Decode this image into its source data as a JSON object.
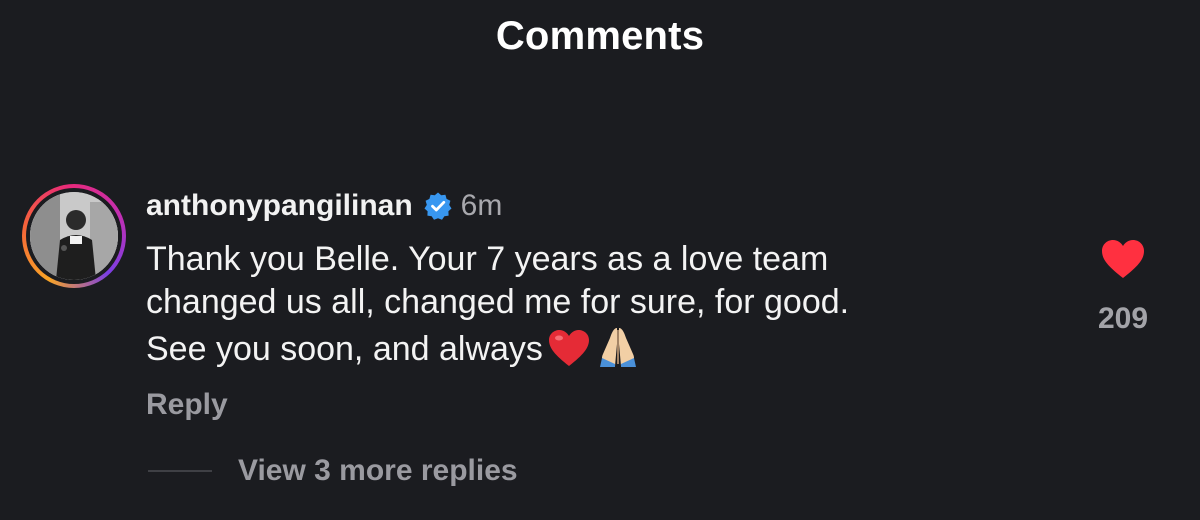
{
  "header": {
    "title": "Comments"
  },
  "comment": {
    "username": "anthonypangilinan",
    "verified": true,
    "timestamp": "6m",
    "text_lines": [
      "Thank you Belle. Your 7 years as a love team",
      "changed us all, changed me for sure, for good.",
      "See you soon, and always"
    ],
    "emojis": [
      "red-heart-emoji",
      "folded-hands-emoji"
    ],
    "reply_label": "Reply",
    "like_count": "209",
    "liked": true,
    "view_replies_label": "View 3 more replies"
  },
  "icons": {
    "verified": "verified-badge-icon",
    "like": "heart-icon"
  },
  "colors": {
    "background": "#1b1c20",
    "verified_badge": "#3897f0",
    "liked_heart": "#ff3040",
    "secondary_text": "#9a9aa0"
  }
}
